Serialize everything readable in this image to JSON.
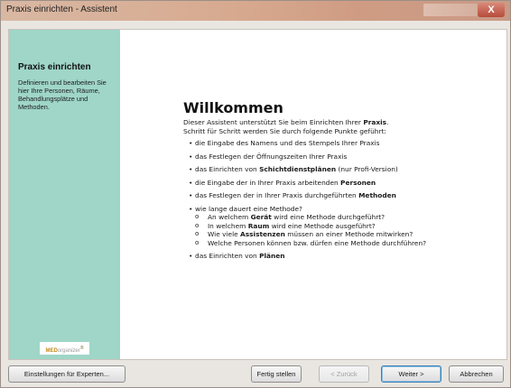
{
  "window": {
    "title": "Praxis einrichten - Assistent",
    "close_symbol": "X"
  },
  "sidebar": {
    "heading": "Praxis einrichten",
    "description": "Definieren und bearbeiten Sie hier Ihre Personen, Räume, Behandlungsplätze und Methoden.",
    "logo": {
      "brand": "MED",
      "name": "organizer",
      "mark": "®"
    }
  },
  "content": {
    "title": "Willkommen",
    "intro": {
      "line1_pre": "Dieser Assistent unterstützt Sie beim Einrichten Ihrer ",
      "line1_bold": "Praxis",
      "line1_post": ".",
      "line2": "Schritt für Schritt werden Sie durch folgende Punkte geführt:"
    },
    "items": [
      {
        "pre": "die Eingabe des Namens und des Stempels Ihrer Praxis",
        "bold": "",
        "post": ""
      },
      {
        "pre": "das Festlegen der Öffnungszeiten Ihrer Praxis",
        "bold": "",
        "post": ""
      },
      {
        "pre": "das Einrichten von ",
        "bold": "Schichtdienstplänen",
        "post": " (nur Profi-Version)"
      },
      {
        "pre": "die Eingabe der in Ihrer Praxis arbeitenden ",
        "bold": "Personen",
        "post": ""
      },
      {
        "pre": "das Festlegen der in Ihrer Praxis durchgeführten ",
        "bold": "Methoden",
        "post": ""
      },
      {
        "pre": "wie lange dauert eine Methode?",
        "bold": "",
        "post": ""
      },
      {
        "pre": "das Einrichten von ",
        "bold": "Plänen",
        "post": ""
      }
    ],
    "subitems": [
      {
        "pre": "An welchem ",
        "bold": "Gerät",
        "post": " wird eine Methode durchgeführt?"
      },
      {
        "pre": "In welchem ",
        "bold": "Raum",
        "post": " wird eine Methode ausgeführt?"
      },
      {
        "pre": "Wie viele ",
        "bold": "Assistenzen",
        "post": " müssen an einer Methode mitwirken?"
      },
      {
        "pre": "Welche Personen können bzw. dürfen eine Methode durchführen?",
        "bold": "",
        "post": ""
      }
    ],
    "bullet": "•",
    "sub_bullet": "o"
  },
  "buttons": {
    "experts": "Einstellungen für Experten...",
    "finish": "Fertig stellen",
    "back": "< Zurück",
    "next": "Weiter >",
    "cancel": "Abbrechen"
  }
}
